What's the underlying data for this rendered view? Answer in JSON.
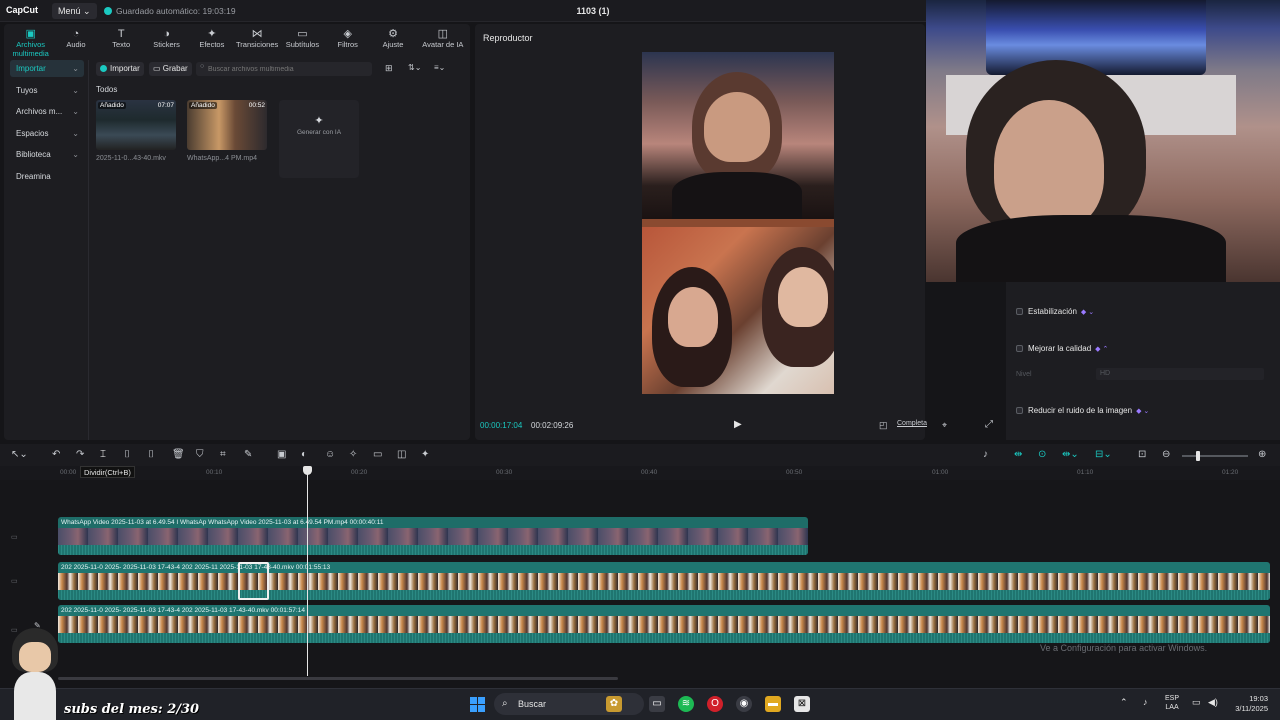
{
  "titlebar": {
    "logo": "CapCut",
    "menu": "Menú ⌄",
    "autosave": "Guardado automático: 19:03:19",
    "project": "1103 (1)"
  },
  "tabs": [
    {
      "icon": "▣",
      "label": "Archivos multimedia"
    },
    {
      "icon": "◔",
      "label": "Audio"
    },
    {
      "icon": "T",
      "label": "Texto"
    },
    {
      "icon": "◑",
      "label": "Stickers"
    },
    {
      "icon": "✦",
      "label": "Efectos"
    },
    {
      "icon": "⋈",
      "label": "Transiciones"
    },
    {
      "icon": "▭",
      "label": "Subtítulos"
    },
    {
      "icon": "◈",
      "label": "Filtros"
    },
    {
      "icon": "⚙",
      "label": "Ajuste"
    },
    {
      "icon": "◫",
      "label": "Avatar de IA"
    }
  ],
  "sidenav": [
    "Importar",
    "Tuyos",
    "Archivos m...",
    "Espacios",
    "Biblioteca",
    "Dreamina"
  ],
  "media": {
    "import": "Importar",
    "record": "Grabar",
    "search_placeholder": "Buscar archivos multimedia",
    "section": "Todos",
    "items": [
      {
        "badge": "Añadido",
        "duration": "07:07",
        "name": "2025-11-0...43-40.mkv"
      },
      {
        "badge": "Añadido",
        "duration": "00:52",
        "name": "WhatsApp...4 PM.mp4"
      }
    ],
    "gen_ai": "Generar con IA"
  },
  "player": {
    "title": "Reproductor",
    "current": "00:00:17:04",
    "total": "00:02:09:26",
    "complete": "Completa"
  },
  "settings": {
    "stabilize": "Estabilización",
    "improve": "Mejorar la calidad",
    "level_label": "Nivel",
    "level_value": "HD",
    "denoise": "Reducir el ruido de la imagen"
  },
  "timeline": {
    "tooltip": "Dividir(Ctrl+B)",
    "ticks": [
      "00:00",
      "00:10",
      "00:20",
      "00:30",
      "00:40",
      "00:50",
      "01:00",
      "01:10",
      "01:20"
    ],
    "clip_a_label": "WhatsApp Video 2025-11-03 at 6.49.54 I  WhatsAp  WhatsApp Video 2025-11-03 at 6.49.54 PM.mp4   00:00:40:11",
    "clip_b_label": "202   2025-11-0   2025-   2025-11-03 17-43-4   202   2025-11   2025-11-03 17-43-40.mkv   00:01:55:13",
    "clip_c_label": "202   2025-11-0   2025-   2025-11-03 17-43-4   202   2025-11-03 17-43-40.mkv   00:01:57:14"
  },
  "overlay": {
    "subs": "subs del mes: 2/30",
    "activate": "Ve a Configuración para activar Windows."
  },
  "taskbar": {
    "search": "Buscar",
    "lang_top": "ESP",
    "lang_bottom": "LAA",
    "time": "19:03",
    "date": "3/11/2025"
  }
}
